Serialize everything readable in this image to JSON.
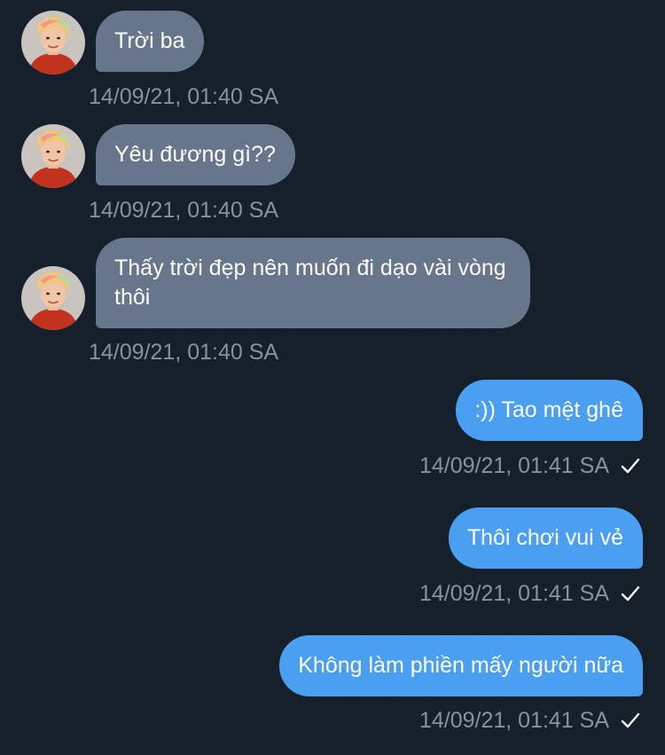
{
  "messages": [
    {
      "direction": "in",
      "text": "Trời ba",
      "time": "14/09/21, 01:40 SA"
    },
    {
      "direction": "in",
      "text": "Yêu đương gì??",
      "time": "14/09/21, 01:40 SA"
    },
    {
      "direction": "in",
      "text": "Thấy trời đẹp nên muốn đi dạo vài vòng thôi",
      "time": "14/09/21, 01:40 SA"
    },
    {
      "direction": "out",
      "text": ":)) Tao mệt ghê",
      "time": "14/09/21, 01:41 SA",
      "status_icon": "check-icon"
    },
    {
      "direction": "out",
      "text": "Thôi chơi vui vẻ",
      "time": "14/09/21, 01:41 SA",
      "status_icon": "check-icon"
    },
    {
      "direction": "out",
      "text": "Không làm phiền mấy người nữa",
      "time": "14/09/21, 01:41 SA",
      "status_icon": "check-icon"
    }
  ],
  "colors": {
    "background": "#15202b",
    "incoming_bubble": "#67768a",
    "outgoing_bubble": "#4a9ff0",
    "timestamp": "#8293a6"
  }
}
